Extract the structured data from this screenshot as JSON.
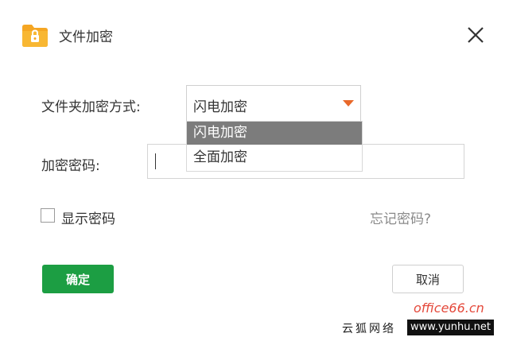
{
  "window": {
    "title": "文件加密",
    "close_icon": "close-icon",
    "app_icon": "lock-folder-icon"
  },
  "form": {
    "method_label": "文件夹加密方式:",
    "method_selected": "闪电加密",
    "method_options": [
      "闪电加密",
      "全面加密"
    ],
    "password_label": "加密密码:",
    "password_value": "",
    "show_password_label": "显示密码",
    "show_password_checked": false,
    "forgot_password": "忘记密码?"
  },
  "buttons": {
    "ok": "确定",
    "cancel": "取消"
  },
  "watermark": {
    "cn": "云狐网络",
    "site": "www.yunhu.net",
    "red": "office66.cn"
  },
  "colors": {
    "accent": "#1c9e43",
    "arrow": "#e8682a",
    "highlight": "#7c7c7c"
  }
}
